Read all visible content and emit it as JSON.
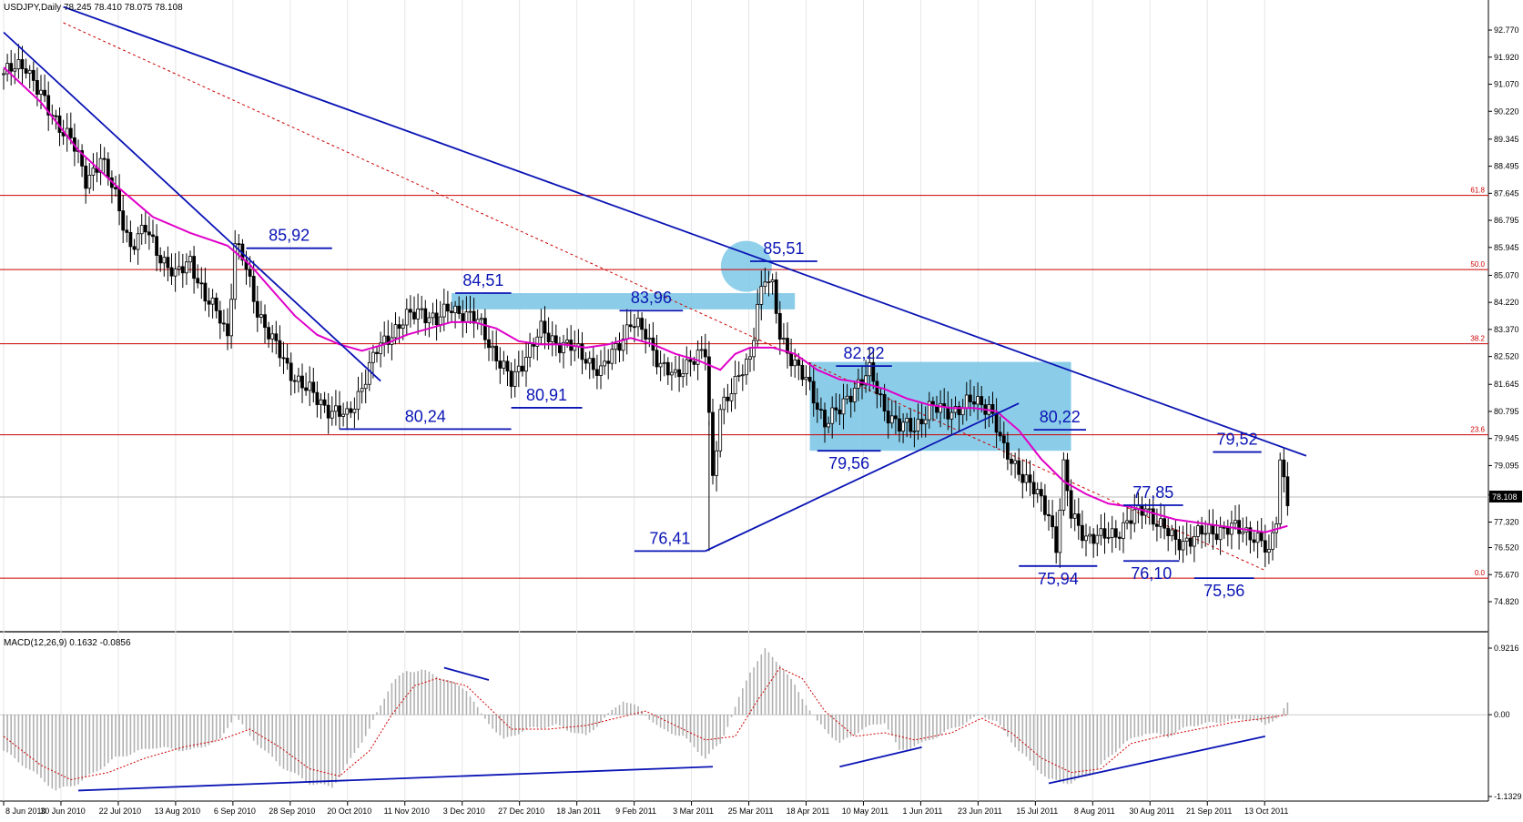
{
  "header": {
    "symbol_line": "USDJPY,Daily  78.245 78.410 78.075 78.108",
    "macd_line": "MACD(12,26,9) 0.1632 -0.0856"
  },
  "colors": {
    "up_candle": "#ffffff",
    "down_candle": "#000000",
    "ma": "#e000c8",
    "trendline": "#0a14b4",
    "fib": "#cc0000",
    "zone": "#7ec8e6",
    "histogram": "#b0b0b0",
    "signal": "#d00000"
  },
  "chart_data": {
    "type": "candlestick",
    "price_axis": {
      "range": [
        74.82,
        93.2
      ],
      "ticks": [
        "92.770",
        "91.920",
        "91.070",
        "90.220",
        "89.345",
        "88.495",
        "87.645",
        "86.795",
        "85.945",
        "85.070",
        "84.220",
        "83.370",
        "82.520",
        "81.645",
        "80.795",
        "79.945",
        "79.095",
        "78.170",
        "77.320",
        "76.520",
        "75.670",
        "74.820"
      ],
      "current": "78.108"
    },
    "date_ticks": [
      "8 Jun 2010",
      "30 Jun 2010",
      "22 Jul 2010",
      "13 Aug 2010",
      "6 Sep 2010",
      "28 Sep 2010",
      "20 Oct 2010",
      "11 Nov 2010",
      "3 Dec 2010",
      "27 Dec 2010",
      "18 Jan 2011",
      "9 Feb 2011",
      "3 Mar 2011",
      "25 Mar 2011",
      "18 Apr 2011",
      "10 May 2011",
      "1 Jun 2011",
      "23 Jun 2011",
      "15 Jul 2011",
      "8 Aug 2011",
      "30 Aug 2011",
      "21 Sep 2011",
      "13 Oct 2011"
    ],
    "close_path": [
      [
        0,
        91.4
      ],
      [
        6,
        91.7
      ],
      [
        12,
        90.2
      ],
      [
        18,
        89.4
      ],
      [
        22,
        88.0
      ],
      [
        26,
        88.8
      ],
      [
        30,
        87.5
      ],
      [
        34,
        86.0
      ],
      [
        38,
        86.5
      ],
      [
        42,
        85.7
      ],
      [
        46,
        85.0
      ],
      [
        50,
        85.6
      ],
      [
        54,
        84.3
      ],
      [
        58,
        83.8
      ],
      [
        60,
        83.2
      ],
      [
        62,
        86.0
      ],
      [
        64,
        85.6
      ],
      [
        68,
        84.0
      ],
      [
        72,
        83.0
      ],
      [
        76,
        82.2
      ],
      [
        80,
        81.6
      ],
      [
        84,
        81.2
      ],
      [
        88,
        80.8
      ],
      [
        92,
        80.6
      ],
      [
        96,
        81.6
      ],
      [
        100,
        82.7
      ],
      [
        104,
        83.3
      ],
      [
        108,
        83.7
      ],
      [
        112,
        84.0
      ],
      [
        116,
        83.6
      ],
      [
        120,
        84.1
      ],
      [
        124,
        83.8
      ],
      [
        128,
        83.5
      ],
      [
        132,
        82.5
      ],
      [
        136,
        81.7
      ],
      [
        140,
        82.6
      ],
      [
        144,
        83.3
      ],
      [
        148,
        83.0
      ],
      [
        152,
        82.8
      ],
      [
        156,
        82.5
      ],
      [
        160,
        82.0
      ],
      [
        164,
        82.8
      ],
      [
        168,
        83.6
      ],
      [
        172,
        83.2
      ],
      [
        176,
        82.3
      ],
      [
        180,
        81.8
      ],
      [
        184,
        82.5
      ],
      [
        188,
        82.6
      ],
      [
        190,
        78.6
      ],
      [
        192,
        81.0
      ],
      [
        196,
        81.6
      ],
      [
        200,
        82.5
      ],
      [
        202,
        84.2
      ],
      [
        204,
        85.0
      ],
      [
        206,
        84.6
      ],
      [
        208,
        83.2
      ],
      [
        212,
        82.3
      ],
      [
        216,
        81.5
      ],
      [
        220,
        80.5
      ],
      [
        224,
        80.8
      ],
      [
        228,
        81.6
      ],
      [
        232,
        82.0
      ],
      [
        236,
        80.9
      ],
      [
        240,
        80.3
      ],
      [
        244,
        80.3
      ],
      [
        248,
        80.9
      ],
      [
        252,
        80.8
      ],
      [
        256,
        80.9
      ],
      [
        260,
        81.1
      ],
      [
        264,
        81.0
      ],
      [
        266,
        80.3
      ],
      [
        268,
        79.5
      ],
      [
        272,
        79.0
      ],
      [
        276,
        78.3
      ],
      [
        280,
        77.6
      ],
      [
        282,
        76.6
      ],
      [
        284,
        79.0
      ],
      [
        286,
        77.5
      ],
      [
        290,
        76.9
      ],
      [
        294,
        76.8
      ],
      [
        298,
        77.0
      ],
      [
        302,
        77.4
      ],
      [
        306,
        77.8
      ],
      [
        310,
        77.2
      ],
      [
        314,
        76.7
      ],
      [
        318,
        76.8
      ],
      [
        322,
        77.0
      ],
      [
        326,
        77.1
      ],
      [
        330,
        77.1
      ],
      [
        334,
        77.0
      ],
      [
        337,
        76.7
      ],
      [
        339,
        76.2
      ],
      [
        341,
        77.5
      ],
      [
        342,
        79.3
      ],
      [
        344,
        78.1
      ]
    ],
    "moving_average": [
      [
        0,
        91.6
      ],
      [
        10,
        90.5
      ],
      [
        20,
        89.0
      ],
      [
        30,
        87.9
      ],
      [
        40,
        86.9
      ],
      [
        50,
        86.4
      ],
      [
        60,
        86.0
      ],
      [
        66,
        85.4
      ],
      [
        72,
        84.6
      ],
      [
        78,
        83.8
      ],
      [
        84,
        83.2
      ],
      [
        90,
        82.9
      ],
      [
        96,
        82.7
      ],
      [
        102,
        82.9
      ],
      [
        108,
        83.2
      ],
      [
        114,
        83.4
      ],
      [
        120,
        83.6
      ],
      [
        126,
        83.6
      ],
      [
        132,
        83.4
      ],
      [
        138,
        83.0
      ],
      [
        144,
        82.9
      ],
      [
        150,
        82.9
      ],
      [
        156,
        82.8
      ],
      [
        162,
        82.9
      ],
      [
        168,
        83.1
      ],
      [
        174,
        82.9
      ],
      [
        180,
        82.6
      ],
      [
        186,
        82.4
      ],
      [
        192,
        82.1
      ],
      [
        196,
        82.6
      ],
      [
        200,
        82.8
      ],
      [
        206,
        82.8
      ],
      [
        212,
        82.6
      ],
      [
        218,
        82.1
      ],
      [
        224,
        81.8
      ],
      [
        230,
        81.7
      ],
      [
        236,
        81.5
      ],
      [
        242,
        81.2
      ],
      [
        248,
        81.0
      ],
      [
        254,
        80.9
      ],
      [
        260,
        80.9
      ],
      [
        266,
        80.8
      ],
      [
        272,
        80.2
      ],
      [
        278,
        79.3
      ],
      [
        284,
        78.6
      ],
      [
        290,
        78.2
      ],
      [
        296,
        77.9
      ],
      [
        302,
        77.8
      ],
      [
        308,
        77.6
      ],
      [
        314,
        77.4
      ],
      [
        320,
        77.3
      ],
      [
        326,
        77.2
      ],
      [
        332,
        77.1
      ],
      [
        338,
        77.0
      ],
      [
        344,
        77.2
      ]
    ],
    "fib_levels": [
      {
        "label": "61.8",
        "price": 87.58
      },
      {
        "label": "50.0",
        "price": 85.25
      },
      {
        "label": "38.2",
        "price": 82.92
      },
      {
        "label": "23.6",
        "price": 80.06
      },
      {
        "label": "0.0",
        "price": 75.56
      }
    ],
    "price_levels": [
      {
        "label": "85,92",
        "price": 85.92
      },
      {
        "label": "85,51",
        "price": 85.51
      },
      {
        "label": "84,51",
        "price": 84.51
      },
      {
        "label": "83,96",
        "price": 83.96
      },
      {
        "label": "82,22",
        "price": 82.22
      },
      {
        "label": "80,91",
        "price": 80.91
      },
      {
        "label": "80,24",
        "price": 80.24
      },
      {
        "label": "80,22",
        "price": 80.22
      },
      {
        "label": "79,56",
        "price": 79.56
      },
      {
        "label": "79,52",
        "price": 79.52
      },
      {
        "label": "77,85",
        "price": 77.85
      },
      {
        "label": "76,41",
        "price": 76.41
      },
      {
        "label": "76,10",
        "price": 76.1
      },
      {
        "label": "75,94",
        "price": 75.94
      },
      {
        "label": "75,56",
        "price": 75.56
      }
    ],
    "macd_axis": {
      "range": [
        -1.1329,
        0.9216
      ],
      "ticks": [
        "0.9216",
        "0.00",
        "-1.1329"
      ]
    },
    "macd_histogram": [
      [
        0,
        -0.5
      ],
      [
        8,
        -0.8
      ],
      [
        14,
        -1.05
      ],
      [
        20,
        -0.95
      ],
      [
        30,
        -0.6
      ],
      [
        40,
        -0.45
      ],
      [
        50,
        -0.5
      ],
      [
        58,
        -0.35
      ],
      [
        62,
        0.0
      ],
      [
        66,
        -0.3
      ],
      [
        74,
        -0.7
      ],
      [
        82,
        -0.95
      ],
      [
        88,
        -1.0
      ],
      [
        92,
        -0.7
      ],
      [
        98,
        -0.2
      ],
      [
        104,
        0.45
      ],
      [
        108,
        0.6
      ],
      [
        112,
        0.62
      ],
      [
        118,
        0.5
      ],
      [
        124,
        0.35
      ],
      [
        128,
        0.0
      ],
      [
        134,
        -0.35
      ],
      [
        140,
        -0.2
      ],
      [
        148,
        -0.15
      ],
      [
        156,
        -0.3
      ],
      [
        162,
        0.0
      ],
      [
        166,
        0.2
      ],
      [
        170,
        0.1
      ],
      [
        176,
        -0.2
      ],
      [
        182,
        -0.3
      ],
      [
        188,
        -0.6
      ],
      [
        192,
        -0.4
      ],
      [
        196,
        0.1
      ],
      [
        200,
        0.6
      ],
      [
        204,
        0.9
      ],
      [
        208,
        0.7
      ],
      [
        212,
        0.4
      ],
      [
        218,
        -0.1
      ],
      [
        224,
        -0.4
      ],
      [
        230,
        -0.2
      ],
      [
        236,
        -0.1
      ],
      [
        240,
        -0.5
      ],
      [
        246,
        -0.4
      ],
      [
        254,
        -0.2
      ],
      [
        262,
        0.0
      ],
      [
        266,
        -0.1
      ],
      [
        272,
        -0.5
      ],
      [
        280,
        -0.9
      ],
      [
        286,
        -0.95
      ],
      [
        292,
        -0.8
      ],
      [
        300,
        -0.4
      ],
      [
        306,
        -0.25
      ],
      [
        312,
        -0.3
      ],
      [
        318,
        -0.15
      ],
      [
        326,
        -0.1
      ],
      [
        334,
        -0.05
      ],
      [
        338,
        -0.15
      ],
      [
        342,
        0.0
      ],
      [
        344,
        0.15
      ]
    ],
    "macd_signal": [
      [
        0,
        -0.3
      ],
      [
        10,
        -0.7
      ],
      [
        18,
        -0.9
      ],
      [
        28,
        -0.8
      ],
      [
        38,
        -0.6
      ],
      [
        48,
        -0.45
      ],
      [
        58,
        -0.35
      ],
      [
        66,
        -0.2
      ],
      [
        74,
        -0.45
      ],
      [
        82,
        -0.75
      ],
      [
        90,
        -0.85
      ],
      [
        98,
        -0.5
      ],
      [
        104,
        0.0
      ],
      [
        110,
        0.4
      ],
      [
        116,
        0.5
      ],
      [
        124,
        0.4
      ],
      [
        130,
        0.1
      ],
      [
        136,
        -0.2
      ],
      [
        146,
        -0.2
      ],
      [
        156,
        -0.15
      ],
      [
        164,
        -0.05
      ],
      [
        172,
        0.05
      ],
      [
        180,
        -0.15
      ],
      [
        188,
        -0.35
      ],
      [
        196,
        -0.3
      ],
      [
        202,
        0.2
      ],
      [
        208,
        0.65
      ],
      [
        214,
        0.5
      ],
      [
        220,
        0.05
      ],
      [
        228,
        -0.3
      ],
      [
        236,
        -0.25
      ],
      [
        244,
        -0.35
      ],
      [
        254,
        -0.25
      ],
      [
        262,
        -0.05
      ],
      [
        270,
        -0.25
      ],
      [
        278,
        -0.6
      ],
      [
        286,
        -0.8
      ],
      [
        294,
        -0.75
      ],
      [
        302,
        -0.4
      ],
      [
        310,
        -0.3
      ],
      [
        320,
        -0.2
      ],
      [
        330,
        -0.1
      ],
      [
        338,
        -0.05
      ],
      [
        344,
        0.0
      ]
    ],
    "price_trendlines": [
      [
        [
          0,
          92.7
        ],
        [
          101,
          81.75
        ]
      ],
      [
        [
          16,
          93.5
        ],
        [
          349,
          79.4
        ]
      ],
      [
        [
          188,
          76.41
        ],
        [
          272,
          81.05
        ]
      ]
    ],
    "macd_trendlines": [
      [
        [
          20,
          -1.05
        ],
        [
          190,
          -0.72
        ]
      ],
      [
        [
          118,
          0.65
        ],
        [
          130,
          0.48
        ]
      ],
      [
        [
          224,
          -0.72
        ],
        [
          246,
          -0.45
        ]
      ],
      [
        [
          280,
          -0.95
        ],
        [
          338,
          -0.3
        ]
      ]
    ],
    "zones": [
      {
        "from": [
          120,
          84.51
        ],
        "to": [
          212,
          84.0
        ]
      },
      {
        "from": [
          216,
          82.35
        ],
        "to": [
          286,
          79.56
        ]
      }
    ]
  }
}
